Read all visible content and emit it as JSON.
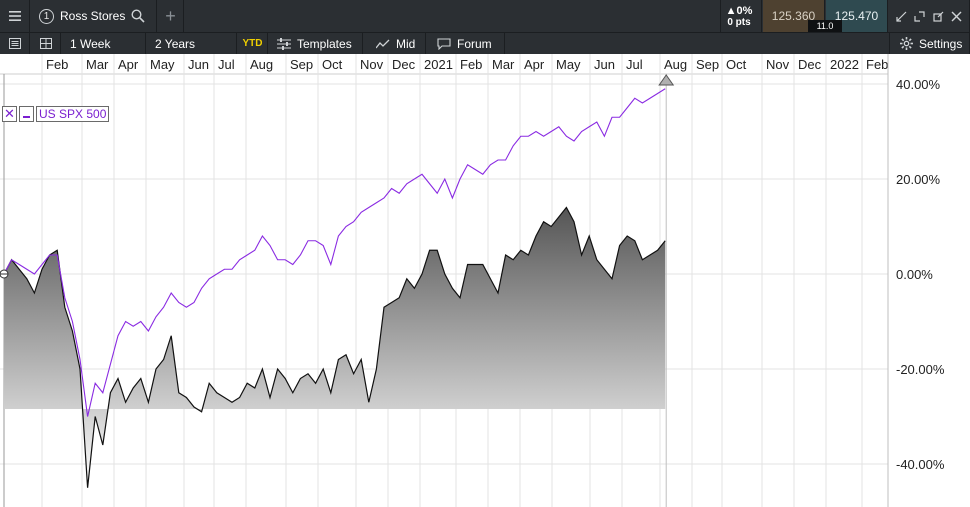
{
  "topbar": {
    "menu_icon": "hamburger-icon",
    "symbol_number": "1",
    "symbol_name": "Ross Stores",
    "search_icon": "search-icon",
    "add_icon": "plus-icon",
    "change_pct": "▲0%",
    "change_pts": "0 pts",
    "bid": "125.360",
    "spread": "11.0",
    "ask": "125.470",
    "window_icons": [
      "shrink-icon",
      "expand-icon",
      "popout-icon",
      "close-icon"
    ]
  },
  "toolbar": {
    "interval": "1 Week",
    "range": "2 Years",
    "ytd": "YTD",
    "templates": "Templates",
    "price_type": "Mid",
    "forum": "Forum",
    "settings": "Settings"
  },
  "legend": {
    "series_name": "US SPX 500"
  },
  "chart_data": {
    "type": "area",
    "x_tick_labels": [
      "Feb",
      "Mar",
      "Apr",
      "May",
      "Jun",
      "Jul",
      "Aug",
      "Sep",
      "Oct",
      "Nov",
      "Dec",
      "2021",
      "Feb",
      "Mar",
      "Apr",
      "May",
      "Jun",
      "Jul",
      "Aug",
      "Sep",
      "Oct",
      "Nov",
      "Dec",
      "2022",
      "Feb"
    ],
    "y_tick_labels": [
      "40.00%",
      "20.00%",
      "0.00%",
      "-20.00%",
      "-40.00%"
    ],
    "ylim": [
      -44,
      40
    ],
    "colors": {
      "main": "#111111",
      "comparison": "#8a2be2",
      "area_top": "#555555",
      "area_bottom": "#ffffff"
    },
    "series": [
      {
        "role": "main",
        "values": [
          0,
          3,
          1,
          -1,
          -4,
          1,
          4,
          5,
          -7,
          -12,
          -20,
          -45,
          -30,
          -36,
          -25,
          -22,
          -27,
          -24,
          -22,
          -27,
          -20,
          -18,
          -13,
          -25,
          -26,
          -28,
          -29,
          -23,
          -25,
          -26,
          -27,
          -26,
          -23,
          -24,
          -20,
          -26,
          -20,
          -22,
          -25,
          -22,
          -21,
          -23,
          -20,
          -25,
          -18,
          -17,
          -21,
          -18,
          -27,
          -20,
          -7,
          -6,
          -5,
          -1,
          -3,
          0,
          5,
          5,
          0,
          -3,
          -5,
          2,
          2,
          2,
          -1,
          -4,
          4,
          3,
          5,
          4,
          8,
          11,
          10,
          12,
          14,
          11,
          4,
          8,
          3,
          1,
          -1,
          6,
          8,
          7,
          3,
          4,
          5,
          7
        ]
      },
      {
        "name": "US SPX 500",
        "role": "comparison",
        "values": [
          0,
          3,
          2,
          1,
          0,
          2,
          4,
          4,
          -5,
          -10,
          -18,
          -30,
          -23,
          -25,
          -19,
          -13,
          -10,
          -11,
          -10,
          -12,
          -9,
          -7,
          -4,
          -6,
          -7,
          -6,
          -3,
          -1,
          0,
          1,
          1,
          3,
          4,
          5,
          8,
          6,
          3,
          3,
          2,
          4,
          7,
          7,
          6,
          2,
          8,
          10,
          11,
          13,
          14,
          15,
          16,
          18,
          17,
          19,
          20,
          21,
          19,
          17,
          20,
          16,
          20,
          23,
          22,
          21,
          23,
          24,
          24,
          27,
          29,
          29,
          30,
          29,
          30,
          31,
          29,
          28,
          30,
          31,
          32,
          29,
          33,
          33,
          35,
          37,
          36,
          37,
          38,
          39
        ]
      }
    ]
  }
}
